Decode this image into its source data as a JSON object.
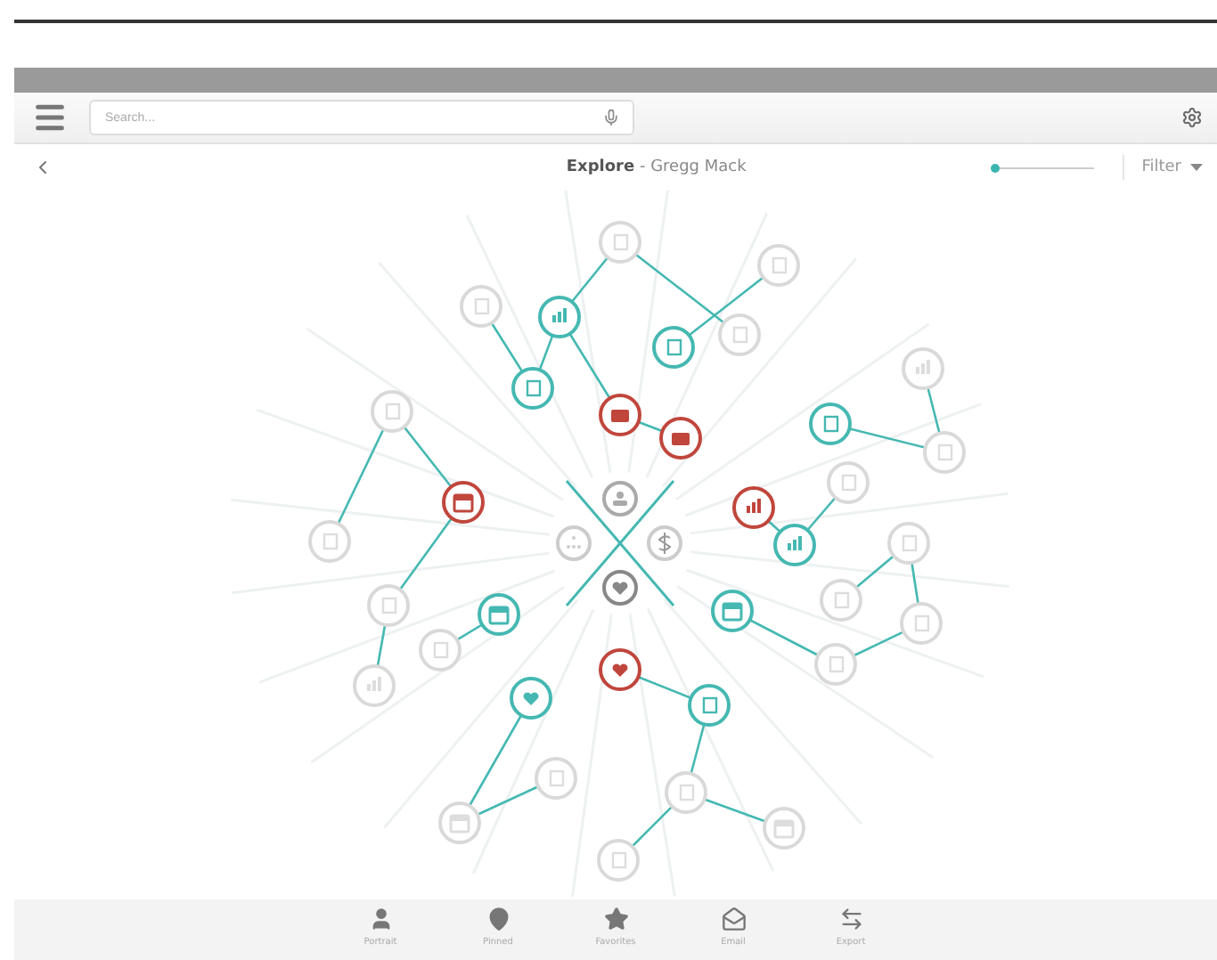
{
  "search": {
    "placeholder": "Search..."
  },
  "header": {
    "title": "**Explore** - Gregg Mack",
    "zoom": {
      "level": 0.02
    },
    "filter": {
      "label": "Filter"
    }
  },
  "tabs": [
    {
      "label": "Portrait",
      "kind": "person"
    },
    {
      "label": "Pinned",
      "kind": "pin"
    },
    {
      "label": "Favorites",
      "kind": "star"
    },
    {
      "label": "Email",
      "kind": "mail"
    },
    {
      "label": "Export",
      "kind": "swap"
    }
  ]
}
